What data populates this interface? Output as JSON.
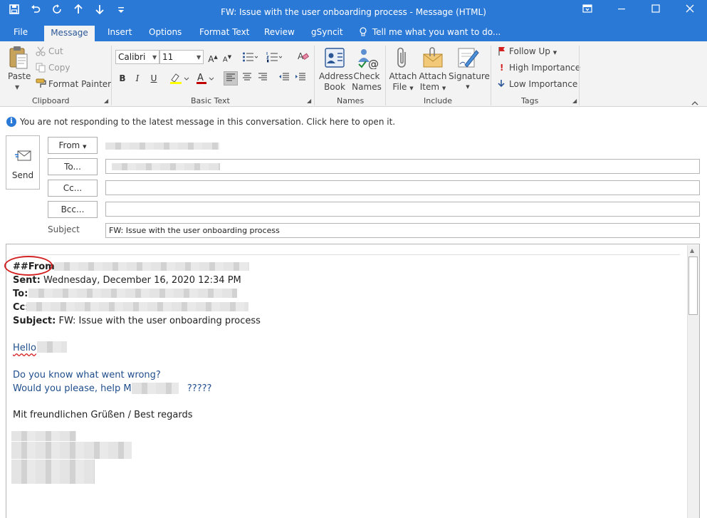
{
  "window": {
    "title": "FW: Issue with the user onboarding process - Message (HTML)"
  },
  "tabs": [
    {
      "label": "File"
    },
    {
      "label": "Message"
    },
    {
      "label": "Insert"
    },
    {
      "label": "Options"
    },
    {
      "label": "Format Text"
    },
    {
      "label": "Review"
    },
    {
      "label": "gSyncit"
    },
    {
      "label": "Tell me what you want to do..."
    }
  ],
  "ribbon": {
    "clipboard": {
      "paste": "Paste",
      "cut": "Cut",
      "copy": "Copy",
      "format_painter": "Format Painter",
      "label": "Clipboard"
    },
    "basic_text": {
      "font": "Calibri",
      "size": "11",
      "bold": "B",
      "italic": "I",
      "underline": "U",
      "grow": "A",
      "shrink": "A",
      "label": "Basic Text",
      "text_color": "#c00000",
      "highlight_color": "#ffff00"
    },
    "names": {
      "address_book": "Address",
      "address_book2": "Book",
      "check_names": "Check",
      "check_names2": "Names",
      "label": "Names"
    },
    "include": {
      "attach_file": "Attach",
      "attach_file2": "File",
      "attach_item": "Attach",
      "attach_item2": "Item",
      "signature": "Signature",
      "label": "Include"
    },
    "tags": {
      "follow_up": "Follow Up",
      "high_importance": "High Importance",
      "low_importance": "Low Importance",
      "label": "Tags"
    }
  },
  "infobar": {
    "text": "You are not responding to the latest message in this conversation. Click here to open it."
  },
  "header": {
    "send": "Send",
    "from": "From",
    "to": "To...",
    "cc": "Cc...",
    "bcc": "Bcc...",
    "subject_label": "Subject",
    "subject_value": "FW: Issue with the user onboarding process"
  },
  "body": {
    "from_label": "##From:",
    "sent_label": "Sent:",
    "sent_value": "Wednesday, December 16, 2020 12:34 PM",
    "to_label": "To:",
    "cc_label": "Cc:",
    "subject_label": "Subject:",
    "subject_value": "FW: Issue with the user onboarding process",
    "greeting": "Hello",
    "line1": "Do you know what went wrong?",
    "line2a": "Would you please, help Mr.",
    "line2b": "?????",
    "closing": "Mit freundlichen Grüßen / Best regards"
  },
  "colors": {
    "accent": "#2b79d6",
    "body_blue": "#1f4e8c",
    "annotation_red": "#d32121"
  }
}
